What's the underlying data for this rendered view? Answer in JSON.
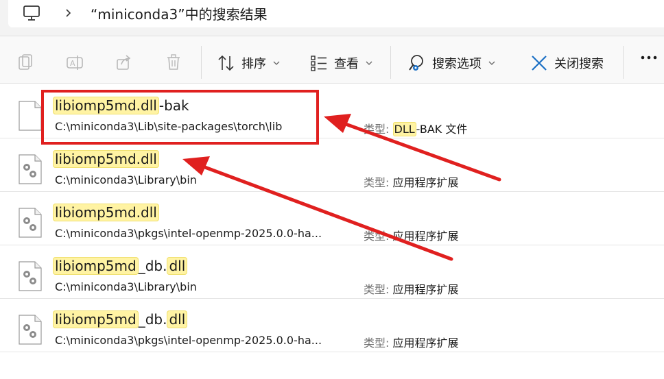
{
  "address_bar": {
    "title": "“miniconda3”中的搜索结果",
    "monitor_icon": "monitor-icon",
    "chevron_icon": "chevron-right-icon"
  },
  "toolbar": {
    "icons_left": [
      "copy-icon",
      "rename-icon",
      "share-icon",
      "delete-icon"
    ],
    "sort_label": "排序",
    "view_label": "查看",
    "search_options_label": "搜索选项",
    "close_search_label": "关闭搜索",
    "more_icon": "more-icon"
  },
  "results": [
    {
      "name_hl": "libiomp5md.dll",
      "name_rest": "-bak",
      "path": "C:\\miniconda3\\Lib\\site-packages\\torch\\lib",
      "type_key": "类型:",
      "type_hl": "DLL",
      "type_rest": "-BAK 文件",
      "icon": "blank-file-icon"
    },
    {
      "name_hl": "libiomp5md.dll",
      "name_rest": "",
      "path": "C:\\miniconda3\\Library\\bin",
      "type_key": "类型:",
      "type_value": "应用程序扩展",
      "icon": "dll-gear-icon"
    },
    {
      "name_hl": "libiomp5md.dll",
      "name_rest": "",
      "path": "C:\\miniconda3\\pkgs\\intel-openmp-2025.0.0-ha...",
      "type_key": "类型:",
      "type_value": "应用程序扩展",
      "icon": "dll-gear-icon"
    },
    {
      "name_hl1": "libiomp5md",
      "name_mid": "_db.",
      "name_hl2": "dll",
      "path": "C:\\miniconda3\\Library\\bin",
      "type_key": "类型:",
      "type_value": "应用程序扩展",
      "icon": "dll-gear-icon"
    },
    {
      "name_hl1": "libiomp5md",
      "name_mid": "_db.",
      "name_hl2": "dll",
      "path": "C:\\miniconda3\\pkgs\\intel-openmp-2025.0.0-ha...",
      "type_key": "类型:",
      "type_value": "应用程序扩展",
      "icon": "dll-gear-icon"
    }
  ],
  "colors": {
    "highlight": "#fff3a3",
    "annotation_red": "#e0201f",
    "accent_blue": "#1a6fc4"
  }
}
